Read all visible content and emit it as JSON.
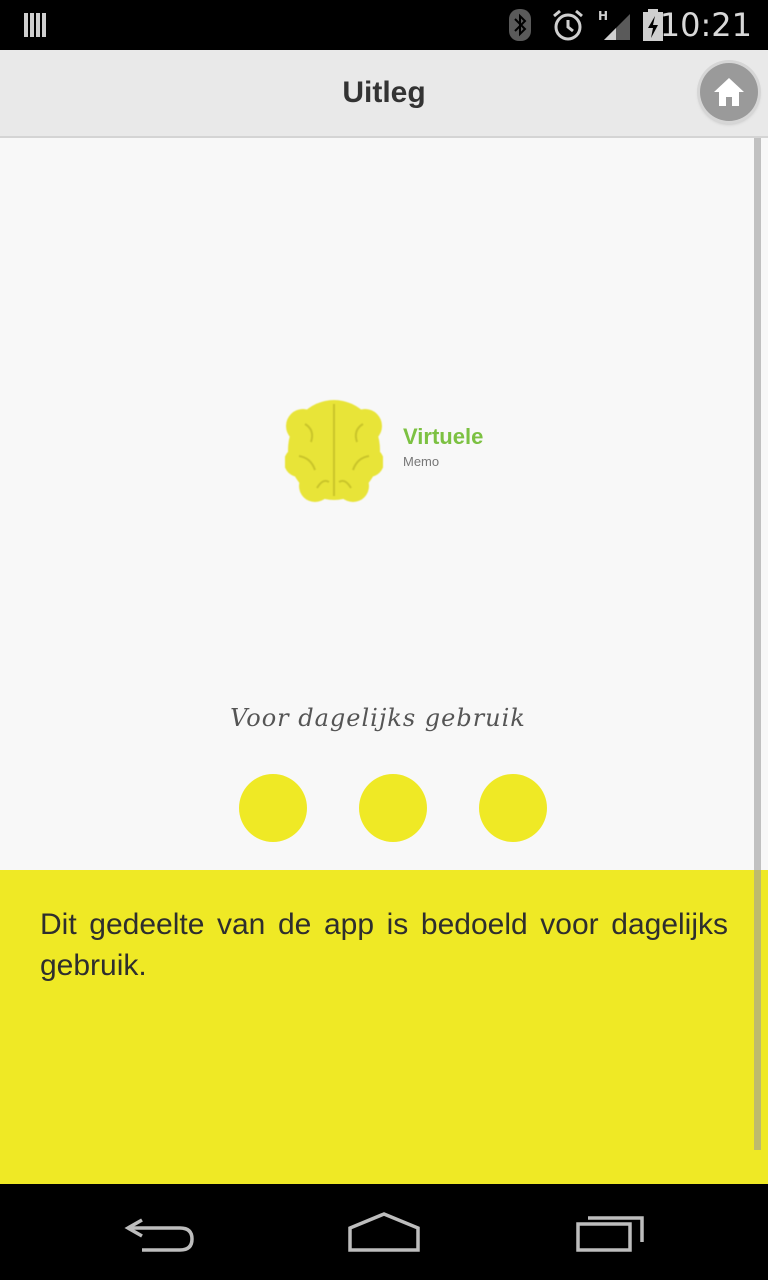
{
  "status_bar": {
    "time": "10:21",
    "network_label": "H",
    "icons": [
      "notification-icon",
      "bluetooth-icon",
      "alarm-icon",
      "signal-icon",
      "battery-charging-icon"
    ]
  },
  "action_bar": {
    "title": "Uitleg",
    "home_icon": "home-icon"
  },
  "illustration": {
    "logo_title": "Virtuele",
    "logo_subtitle": "Memo",
    "logo_icon": "brain-icon",
    "tagline": "Voor dagelijks gebruik",
    "dots_count": 3
  },
  "explanation": {
    "text": "Dit gedeelte van de app is bedoeld voor dagelijks gebruik."
  },
  "nav_bar": {
    "icons": [
      "back-icon",
      "home-outline-icon",
      "recent-apps-icon"
    ]
  },
  "colors": {
    "accent_yellow": "#efe925",
    "logo_green": "#7cc142",
    "action_bar": "#e9e9e9",
    "background": "#f8f8f8"
  }
}
